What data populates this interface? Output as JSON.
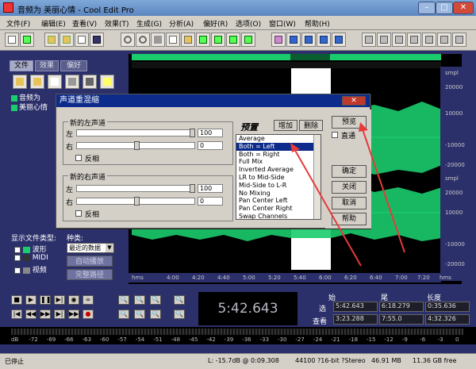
{
  "window": {
    "title": "音频为  美丽心情 - Cool Edit Pro",
    "doc_title": "音频为",
    "file_name": "美丽心情"
  },
  "menu": [
    "文件(F)",
    "编辑(E)",
    "查看(V)",
    "效果(T)",
    "生成(G)",
    "分析(A)",
    "偏好(R)",
    "选项(O)",
    "窗口(W)",
    "帮助(H)"
  ],
  "left_tabs": [
    "文件",
    "效果",
    "偏好"
  ],
  "files": [
    "音频为",
    "美丽心情"
  ],
  "display_filter_label": "显示文件类型:",
  "file_types": [
    "波形",
    "MIDI",
    "视频"
  ],
  "sort_label": "种类:",
  "sort_value": "最近的数据",
  "auto_play_button": "自动播放",
  "full_path_button": "完整路径",
  "dialog": {
    "title": "声道重混缩",
    "left_group": "新的左声道",
    "right_group": "新的右声道",
    "left_label": "左",
    "right_label": "右",
    "left_left_value": "100",
    "left_right_value": "0",
    "right_left_value": "100",
    "right_right_value": "0",
    "invert_label": "反相",
    "presets_title": "预置",
    "add_button": "增加",
    "delete_button": "删除",
    "presets": [
      "Average",
      "Both = Left",
      "Both = Right",
      "Full Mix",
      "Inverted Average",
      "LR to Mid-Side",
      "Mid-Side to L-R",
      "No Mixing",
      "Pan Center Left",
      "Pan Center Right",
      "Swap Channels"
    ],
    "selected_preset": "Both = Left",
    "preview_button": "预览",
    "direct_label": "直通",
    "ok_button": "确定",
    "close_button": "关闭",
    "cancel_button": "取消",
    "help_button": "帮助"
  },
  "wave": {
    "ruler_unit": "hms",
    "timeline": [
      "4:00",
      "4:20",
      "4:40",
      "5:00",
      "5:20",
      "5:40",
      "6:00",
      "6:20",
      "6:40",
      "7:00",
      "7:20"
    ],
    "amp_labels": [
      "smpl",
      "20000",
      "10000",
      "-10000",
      "-20000",
      "smpl",
      "20000",
      "10000",
      "-10000",
      "-20000"
    ],
    "right_unit": "hms"
  },
  "transport": {
    "time": "5:42.643",
    "start_label": "始",
    "end_label": "尾",
    "length_label": "长度",
    "select_label": "选",
    "view_label": "查看",
    "sel_start": "5:42.643",
    "sel_end": "6:18.279",
    "sel_length": "0:35.636",
    "view_start": "3:23.288",
    "view_end": "7:55.0",
    "view_length": "4:32.326"
  },
  "levels": [
    "dB",
    "-72",
    "-69",
    "-66",
    "-63",
    "-60",
    "-57",
    "-54",
    "-51",
    "-48",
    "-45",
    "-42",
    "-39",
    "-36",
    "-33",
    "-30",
    "-27",
    "-24",
    "-21",
    "-18",
    "-15",
    "-12",
    "-9",
    "-6",
    "-3",
    "0"
  ],
  "status": {
    "state": "已停止",
    "levels": "L: -15.7dB @ 0:09.308",
    "format": "44100 ?16-bit ?Stereo",
    "size": "46.91 MB",
    "free": "11.36 GB free"
  },
  "colors": {
    "accent": "#0c2b8a",
    "waveform": "#1bcc6d",
    "background": "#2b2f6a"
  }
}
